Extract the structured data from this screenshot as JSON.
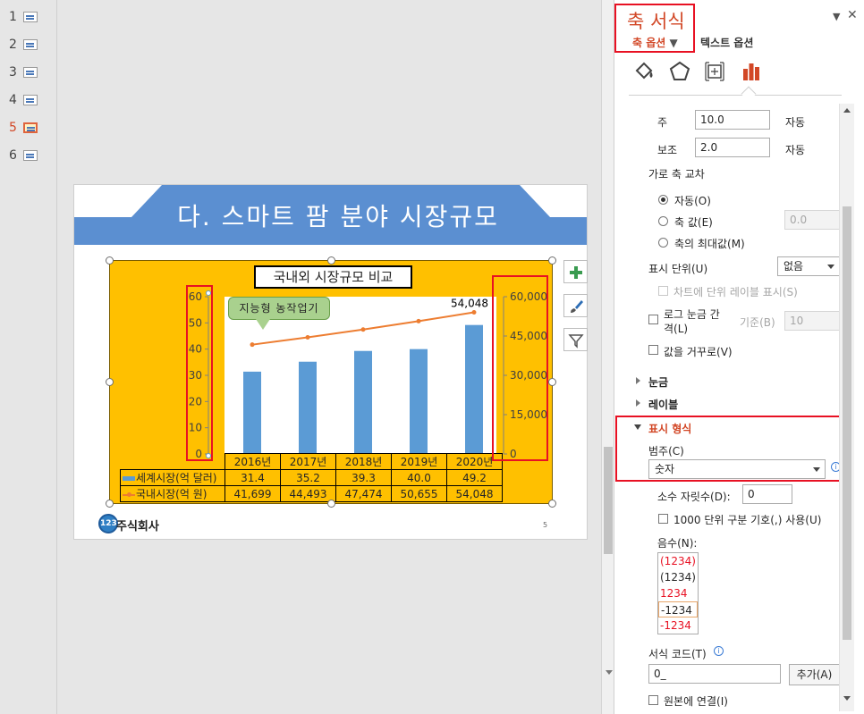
{
  "thumbnails": [
    {
      "num": "1"
    },
    {
      "num": "2"
    },
    {
      "num": "3"
    },
    {
      "num": "4"
    },
    {
      "num": "5",
      "active": true
    },
    {
      "num": "6"
    }
  ],
  "slide": {
    "title": "다. 스마트 팜 분야 시장규모",
    "chart_title": "국내외 시장규모 비교",
    "callout": "지능형 농작업기",
    "logo_badge": "123",
    "logo_text": "주식회사",
    "page_number": "5"
  },
  "chart_data": {
    "type": "bar",
    "title": "국내외 시장규모 비교",
    "categories": [
      "2016년",
      "2017년",
      "2018년",
      "2019년",
      "2020년"
    ],
    "series": [
      {
        "name": "세계시장(억 달러)",
        "kind": "bar",
        "axis": "left",
        "color": "#5b9bd5",
        "values": [
          31.4,
          35.2,
          39.3,
          40.0,
          49.2
        ]
      },
      {
        "name": "국내시장(억 원)",
        "kind": "line",
        "axis": "right",
        "color": "#ed7d31",
        "values": [
          41699,
          44493,
          47474,
          50655,
          54048
        ]
      }
    ],
    "left_axis": {
      "ylim": [
        0,
        60
      ],
      "ticks": [
        "0",
        "10",
        "20",
        "30",
        "40",
        "50",
        "60"
      ]
    },
    "right_axis": {
      "ylim": [
        0,
        60000
      ],
      "ticks": [
        "0",
        "15,000",
        "30,000",
        "45,000",
        "60,000"
      ]
    },
    "data_labels": {
      "last_point": "54,048"
    },
    "table_rows": [
      {
        "label": "세계시장(억 달러)",
        "cells": [
          "31.4",
          "35.2",
          "39.3",
          "40.0",
          "49.2"
        ]
      },
      {
        "label": "국내시장(억 원)",
        "cells": [
          "41,699",
          "44,493",
          "47,474",
          "50,655",
          "54,048"
        ]
      }
    ]
  },
  "pane": {
    "title": "축 서식",
    "tab_axis": "축 옵션",
    "tab_text": "텍스트 옵션",
    "icons": [
      "fill-bucket-icon",
      "pentagon-icon",
      "size-properties-icon",
      "bar-chart-icon"
    ],
    "major_label": "주",
    "major_value": "10.0",
    "major_auto": "자동",
    "minor_label": "보조",
    "minor_value": "2.0",
    "minor_auto": "자동",
    "cross_title": "가로 축 교차",
    "cross_auto": "자동(O)",
    "cross_value_label": "축 값(E)",
    "cross_value": "0.0",
    "cross_max": "축의 최대값(M)",
    "display_units_label": "표시 단위(U)",
    "display_units_value": "없음",
    "show_units_label": "차트에 단위 레이블 표시(S)",
    "log_label": "로그 눈금 간격(L)",
    "log_base_label": "기준(B)",
    "log_base_value": "10",
    "reverse_label": "값을 거꾸로(V)",
    "sec_ticks": "눈금",
    "sec_labels": "레이블",
    "sec_number": "표시 형식",
    "category_label": "범주(C)",
    "category_value": "숫자",
    "decimals_label": "소수 자릿수(D):",
    "decimals_value": "0",
    "thousands_label": "1000 단위 구분 기호(,) 사용(U)",
    "negative_label": "음수(N):",
    "negative_options": [
      {
        "text": "(1234)",
        "color": "#e81123"
      },
      {
        "text": "(1234)",
        "color": "#262626"
      },
      {
        "text": "1234",
        "color": "#e81123"
      },
      {
        "text": "-1234",
        "color": "#262626",
        "selected": true
      },
      {
        "text": "-1234",
        "color": "#e81123"
      }
    ],
    "format_code_label": "서식 코드(T)",
    "format_code_value": "0_",
    "add_button": "추가(A)",
    "link_source_label": "원본에 연결(I)"
  }
}
